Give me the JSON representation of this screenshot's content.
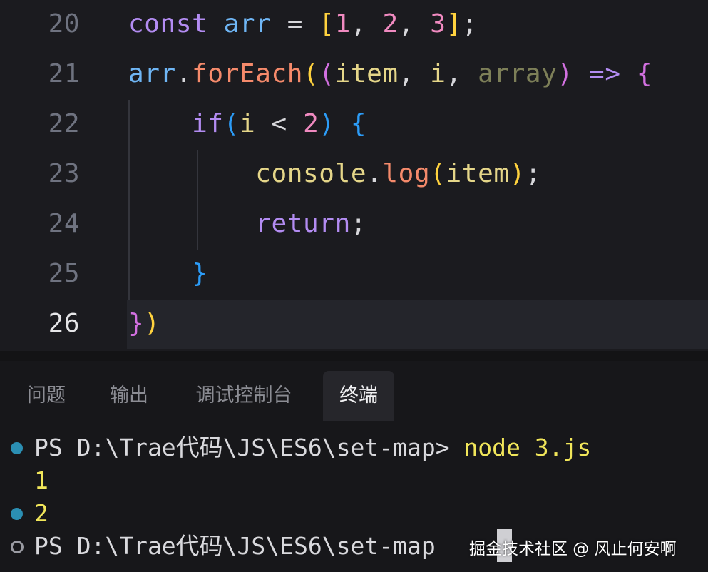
{
  "editor": {
    "lines": [
      {
        "number": "20"
      },
      {
        "number": "21"
      },
      {
        "number": "22"
      },
      {
        "number": "23"
      },
      {
        "number": "24"
      },
      {
        "number": "25"
      },
      {
        "number": "26"
      }
    ],
    "tokens": {
      "l20": {
        "const": "const",
        "arr": "arr",
        "eq": "=",
        "lb": "[",
        "n1": "1",
        "c1": ",",
        "n2": "2",
        "c2": ",",
        "n3": "3",
        "rb": "]",
        "semi": ";"
      },
      "l21": {
        "arr": "arr",
        "dot": ".",
        "forEach": "forEach",
        "lp1": "(",
        "lp2": "(",
        "item": "item",
        "c1": ",",
        "i": "i",
        "c2": ",",
        "array": "array",
        "rp2": ")",
        "arrow": "=>",
        "lb": "{"
      },
      "l22": {
        "if": "if",
        "lp": "(",
        "i": "i",
        "lt": "<",
        "n2": "2",
        "rp": ")",
        "lb": "{"
      },
      "l23": {
        "console": "console",
        "dot": ".",
        "log": "log",
        "lp": "(",
        "item": "item",
        "rp": ")",
        "semi": ";"
      },
      "l24": {
        "return": "return",
        "semi": ";"
      },
      "l25": {
        "rb": "}"
      },
      "l26": {
        "rb": "}",
        "rp": ")"
      }
    }
  },
  "panel": {
    "tabs": [
      {
        "label": "问题"
      },
      {
        "label": "输出"
      },
      {
        "label": "调试控制台"
      },
      {
        "label": "终端"
      }
    ],
    "active_tab": "终端",
    "terminal": [
      {
        "prompt": "PS D:\\Trae代码\\JS\\ES6\\set-map> ",
        "command": "node 3.js",
        "status": "ok"
      },
      {
        "output": "1"
      },
      {
        "output": "2",
        "status": "ok"
      },
      {
        "prompt": "PS D:\\Trae代码\\JS\\ES6\\set-map",
        "status": "pending"
      }
    ]
  },
  "watermark": "掘金技术社区 @ 风止何安啊",
  "colors": {
    "editor_bg": "#1b1b1f",
    "active_line_bg": "#24252b",
    "keyword": "#b38cf2",
    "variable": "#6fb6f5",
    "number": "#f08ac0",
    "function": "#f58a6b",
    "bracket_1": "#ffd23e",
    "bracket_2": "#d270e0",
    "bracket_3": "#2c9cf7",
    "terminal_command": "#f1e65a",
    "status_ok": "#2b8fb3"
  }
}
